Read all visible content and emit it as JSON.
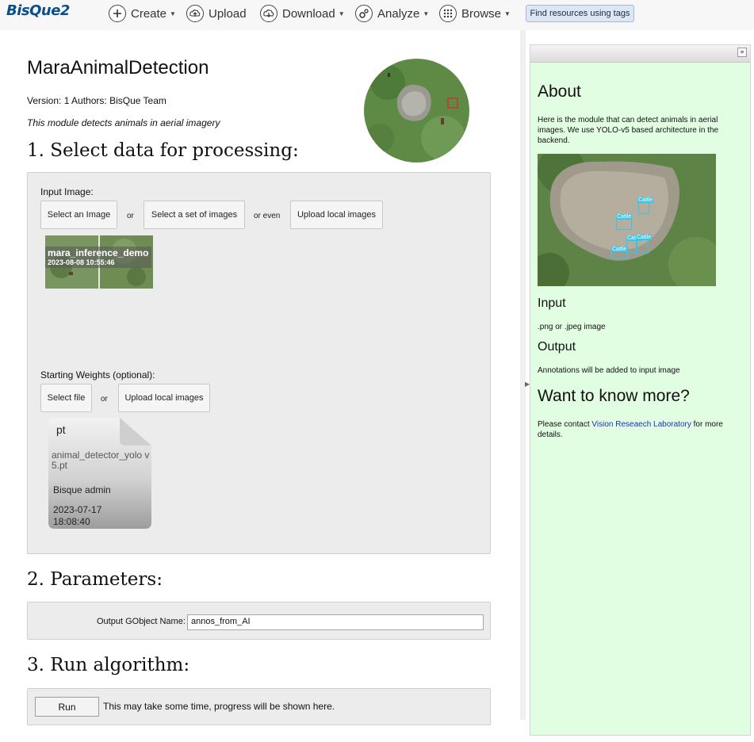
{
  "app": {
    "logo": "BisQue2"
  },
  "nav": {
    "create": "Create",
    "upload": "Upload",
    "download": "Download",
    "analyze": "Analyze",
    "browse": "Browse",
    "tag_search": "Find resources using tags",
    "icons": {
      "create": "plus-circle-icon",
      "upload": "upload-cloud-icon",
      "download": "download-cloud-icon",
      "analyze": "gears-icon",
      "browse": "grid-icon"
    }
  },
  "module": {
    "title": "MaraAnimalDetection",
    "meta": "Version: 1 Authors: BisQue Team",
    "description": "This module detects animals in aerial imagery"
  },
  "step1": {
    "heading": "1. Select data for processing:",
    "input_label": "Input Image:",
    "select_image": "Select an Image",
    "or1": "or",
    "select_set": "Select a set of images",
    "or_even": "or even",
    "upload_local": "Upload local images",
    "thumbnail": {
      "name": "mara_inference_demo",
      "date": "2023-08-08 10:55:46"
    },
    "weights_label": "Starting Weights (optional):",
    "select_file": "Select file",
    "or2": "or",
    "upload_local2": "Upload local images",
    "file": {
      "ext": "pt",
      "name": "animal_detector_yolo v5.pt",
      "owner": "Bisque admin",
      "date": "2023-07-17",
      "time": "18:08:40"
    }
  },
  "step2": {
    "heading": "2. Parameters:",
    "param_label": "Output GObject Name:",
    "param_value": "annos_from_AI"
  },
  "step3": {
    "heading": "3. Run algorithm:",
    "run_button": "Run",
    "run_message": "This may take some time, progress will be shown here."
  },
  "side": {
    "about_title": "About",
    "about_text": "Here is the module that can detect animals in aerial images. We use YOLO-v5 based architecture in the backend.",
    "detection_labels": [
      "Cattle",
      "Cattle",
      "Cattle",
      "Cattle",
      "Cattle"
    ],
    "input_title": "Input",
    "input_text": ".png or .jpeg image",
    "output_title": "Output",
    "output_text": "Annotations will be added to input image",
    "more_title": "Want to know more?",
    "contact_prefix": "Please contact",
    "contact_link": "Vision Reseaech Laboratory",
    "contact_suffix": "for more details."
  },
  "colors": {
    "side_bg": "#e2fee2",
    "panel_bg": "#ececec",
    "link": "#1f2fb8",
    "detection_box": "#39c6e6"
  }
}
